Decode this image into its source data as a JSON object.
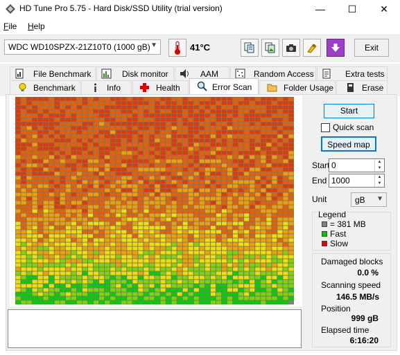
{
  "window": {
    "title": "HD Tune Pro 5.75 - Hard Disk/SSD Utility (trial version)",
    "controls": {
      "minimize": "—",
      "maximize": "☐",
      "close": "✕"
    }
  },
  "menu": [
    {
      "label": "File",
      "accel": "F",
      "rest": "ile"
    },
    {
      "label": "Help",
      "accel": "H",
      "rest": "elp"
    }
  ],
  "toolbar": {
    "drive": "WDC WD10SPZX-21Z10T0 (1000 gB)",
    "temperature": "41°C",
    "exit_label": "Exit",
    "icons": [
      "thermometer-icon",
      "copy-text-icon",
      "copy-image-icon",
      "screenshot-camera-icon",
      "options-icon",
      "save-icon"
    ]
  },
  "tabs_top": [
    {
      "label": "File Benchmark",
      "icon": "file-benchmark-icon"
    },
    {
      "label": "Disk monitor",
      "icon": "disk-monitor-icon"
    },
    {
      "label": "AAM",
      "icon": "speaker-icon"
    },
    {
      "label": "Random Access",
      "icon": "random-access-icon"
    },
    {
      "label": "Extra tests",
      "icon": "extra-tests-icon"
    }
  ],
  "tabs_bottom": [
    {
      "label": "Benchmark",
      "icon": "lightbulb-icon"
    },
    {
      "label": "Info",
      "icon": "info-icon"
    },
    {
      "label": "Health",
      "icon": "health-cross-icon"
    },
    {
      "label": "Error Scan",
      "icon": "magnifier-icon",
      "active": true
    },
    {
      "label": "Folder Usage",
      "icon": "folder-icon"
    },
    {
      "label": "Erase",
      "icon": "erase-icon"
    }
  ],
  "controls": {
    "start_button": "Start",
    "quick_scan_label": "Quick scan",
    "quick_scan_checked": false,
    "speed_map_button": "Speed map",
    "start_label": "Start",
    "start_value": "0",
    "end_label": "End",
    "end_value": "1000",
    "unit_label": "Unit",
    "unit_value": "gB"
  },
  "legend": {
    "title": "Legend",
    "items": [
      {
        "label": "= 381 MB",
        "color": "#808080"
      },
      {
        "label": "Fast",
        "color": "#00c800"
      },
      {
        "label": "Slow",
        "color": "#e60000"
      }
    ]
  },
  "stats": {
    "damaged_label": "Damaged blocks",
    "damaged_value": "0.0 %",
    "speed_label": "Scanning speed",
    "speed_value": "146.5 MB/s",
    "position_label": "Position",
    "position_value": "999 gB",
    "elapsed_label": "Elapsed time",
    "elapsed_value": "6:16:20"
  },
  "scan_map": {
    "colors": [
      "#00d200",
      "#7ad800",
      "#f0e000",
      "#f0a000",
      "#e86000",
      "#e03a00"
    ],
    "speed_profile": "fast at end of disk (bottom rows), slow at start (top rows)"
  }
}
